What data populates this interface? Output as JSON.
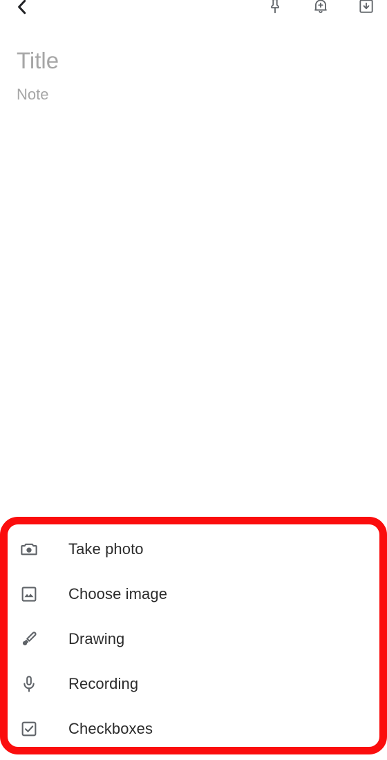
{
  "app": {
    "screen_name": "note-editor",
    "background_color": "#ffffff"
  },
  "appbar": {
    "back_label": "Back",
    "back_icon": "chevron-left-icon",
    "actions": [
      {
        "name": "pin",
        "label": "Pin note",
        "icon": "pin-icon"
      },
      {
        "name": "reminder",
        "label": "Add reminder",
        "icon": "bell-plus-icon"
      },
      {
        "name": "archive",
        "label": "Archive",
        "icon": "archive-down-arrow-icon"
      }
    ]
  },
  "editor": {
    "title": {
      "value": "",
      "placeholder": "Title"
    },
    "note": {
      "value": "",
      "placeholder": "Note"
    }
  },
  "highlight": {
    "color": "#fb0d0d",
    "target": "add-attachment-bottom-sheet"
  },
  "bottom_sheet": {
    "items": [
      {
        "label": "Take photo",
        "icon": "camera-icon"
      },
      {
        "label": "Choose image",
        "icon": "image-icon"
      },
      {
        "label": "Drawing",
        "icon": "brush-icon"
      },
      {
        "label": "Recording",
        "icon": "microphone-icon"
      },
      {
        "label": "Checkboxes",
        "icon": "checkbox-checked-icon"
      }
    ],
    "icon_color": "#5f6368",
    "text_color": "#2b2b2b"
  }
}
